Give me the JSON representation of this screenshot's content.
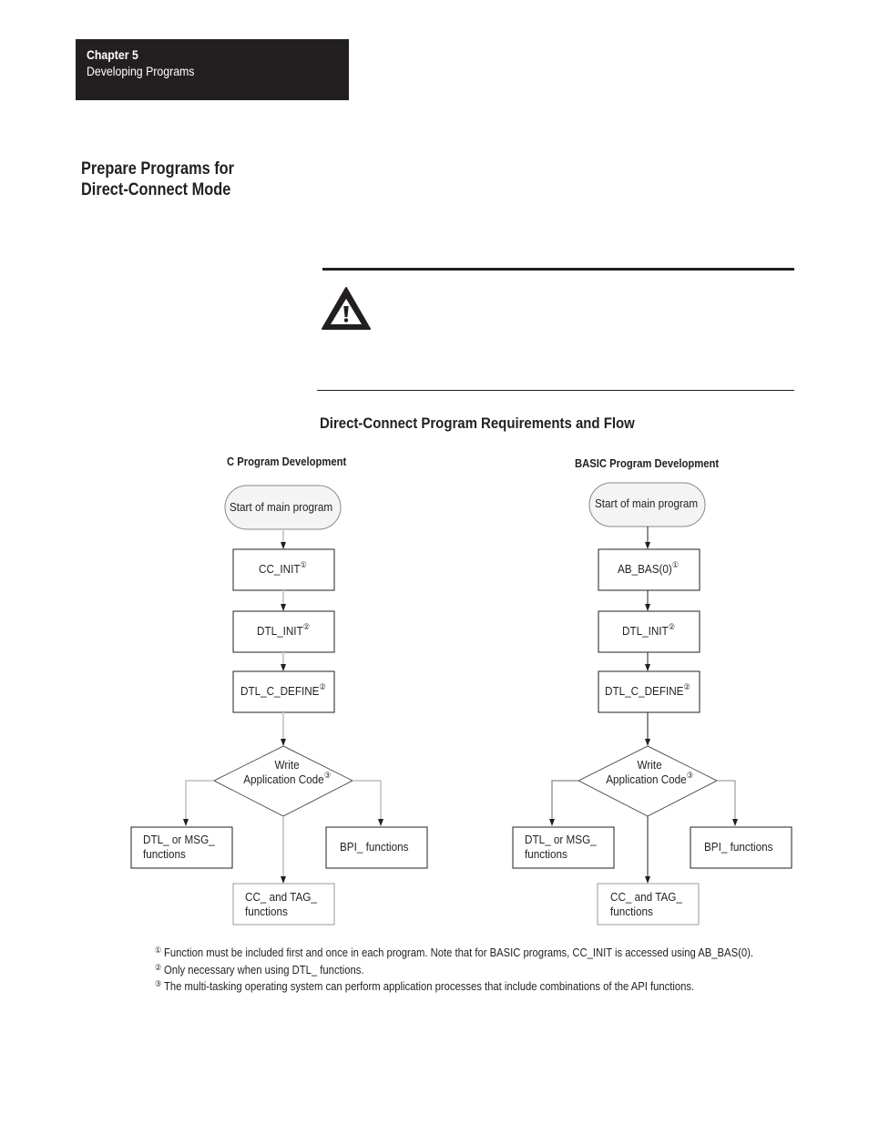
{
  "header": {
    "chapter_label": "Chapter  5",
    "chapter_title": "Developing Programs"
  },
  "section": {
    "title_line1": "Prepare Programs for",
    "title_line2": "Direct-Connect Mode"
  },
  "warning": {
    "icon": "warning-triangle-icon"
  },
  "figure": {
    "title": "Direct-Connect Program Requirements and Flow",
    "c_column": {
      "title": "C Program Development",
      "start": "Start of main program",
      "step1": "CC_INIT",
      "step1_note": "①",
      "step2": "DTL_INIT",
      "step2_note": "②",
      "step3": "DTL_C_DEFINE",
      "step3_note": "②",
      "decision_line1": "Write",
      "decision_line2": "Application Code",
      "decision_note": "③",
      "left_out_line1": "DTL_ or MSG_",
      "left_out_line2": "functions",
      "right_out": "BPI_ functions",
      "bottom_out_line1": "CC_ and TAG_",
      "bottom_out_line2": "functions"
    },
    "basic_column": {
      "title": "BASIC Program Development",
      "start": "Start of main program",
      "step1": "AB_BAS(0)",
      "step1_note": "①",
      "step2": "DTL_INIT",
      "step2_note": "②",
      "step3": "DTL_C_DEFINE",
      "step3_note": "②",
      "decision_line1": "Write",
      "decision_line2": "Application Code",
      "decision_note": "③",
      "left_out_line1": "DTL_ or MSG_",
      "left_out_line2": "functions",
      "right_out": "BPI_ functions",
      "bottom_out_line1": "CC_ and TAG_",
      "bottom_out_line2": "functions"
    }
  },
  "footnotes": [
    {
      "marker": "①",
      "text": "Function must be included first and once in each program.  Note that for BASIC programs, CC_INIT is accessed using AB_BAS(0)."
    },
    {
      "marker": "②",
      "text": "Only necessary when using DTL_ functions."
    },
    {
      "marker": "③",
      "text": "The multi-tasking operating system can perform application processes that include combinations of the API functions."
    }
  ],
  "colors": {
    "ink": "#231f20",
    "connector_light": "#cfcfcf",
    "start_fill": "#f4f4f4"
  }
}
